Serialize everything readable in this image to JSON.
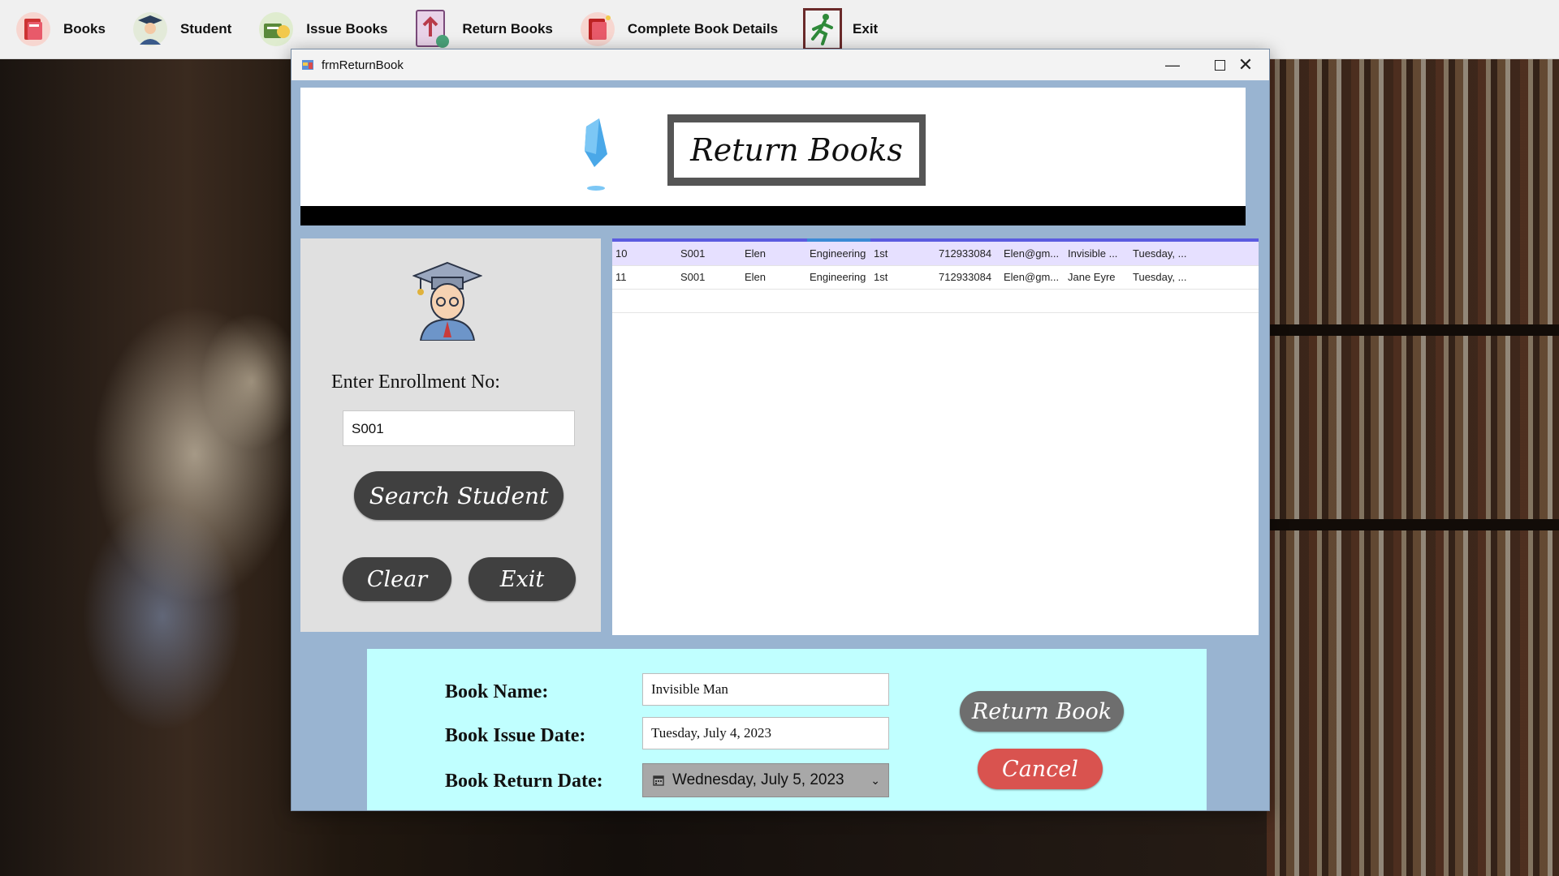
{
  "menubar": {
    "items": [
      {
        "label": "Books",
        "icon": "books-icon"
      },
      {
        "label": "Student",
        "icon": "student-icon"
      },
      {
        "label": "Issue Books",
        "icon": "issue-books-icon"
      },
      {
        "label": "Return Books",
        "icon": "return-books-icon"
      },
      {
        "label": "Complete Book Details",
        "icon": "book-details-icon"
      },
      {
        "label": "Exit",
        "icon": "exit-running-icon"
      }
    ]
  },
  "window": {
    "title": "frmReturnBook",
    "banner_title": "Return Books"
  },
  "left_panel": {
    "enroll_label": "Enter Enrollment No:",
    "enroll_value": "S001",
    "search_label": "Search Student",
    "clear_label": "Clear",
    "exit_label": "Exit"
  },
  "grid": {
    "rows": [
      {
        "cells": [
          "10",
          "S001",
          "Elen",
          "Engineering",
          "1st",
          "712933084",
          "Elen@gm...",
          "Invisible ...",
          "Tuesday, ..."
        ],
        "selected": true
      },
      {
        "cells": [
          "11",
          "S001",
          "Elen",
          "Engineering",
          "1st",
          "712933084",
          "Elen@gm...",
          "Jane Eyre",
          "Tuesday, ..."
        ],
        "selected": false
      }
    ]
  },
  "bottom_panel": {
    "book_name_label": "Book Name:",
    "book_name_value": "Invisible Man",
    "issue_date_label": "Book Issue Date:",
    "issue_date_value": "Tuesday, July 4, 2023",
    "return_date_label": "Book Return Date:",
    "return_date_value": "Wednesday, July 5, 2023",
    "return_button": "Return Book",
    "cancel_button": "Cancel"
  },
  "colors": {
    "window_bg": "#99b4d1",
    "bottom_panel_bg": "#c0ffff",
    "cancel_button": "#d9534f",
    "return_button": "#6e6e6e",
    "pill_button": "#404040"
  }
}
